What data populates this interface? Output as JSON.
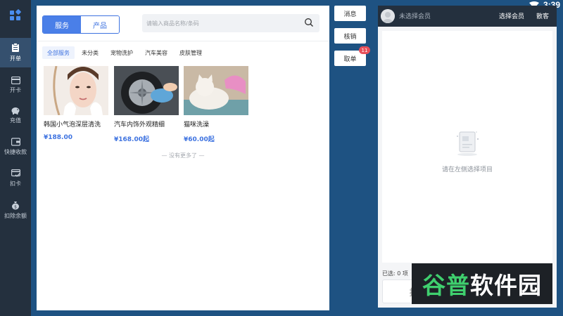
{
  "status_bar": {
    "time": "3:39"
  },
  "sidebar": {
    "items": [
      {
        "label": "开单",
        "icon": "clipboard-icon"
      },
      {
        "label": "开卡",
        "icon": "card-icon"
      },
      {
        "label": "充值",
        "icon": "piggy-bank-icon"
      },
      {
        "label": "快捷收款",
        "icon": "wallet-icon"
      },
      {
        "label": "扣卡",
        "icon": "card-check-icon"
      },
      {
        "label": "扣除余额",
        "icon": "money-bag-icon"
      }
    ],
    "active_index": 0
  },
  "products": {
    "tabs": [
      "服务",
      "产品"
    ],
    "active_tab": 0,
    "search_placeholder": "请输入商品名称/条码",
    "categories": [
      "全部服务",
      "未分类",
      "宠物洗护",
      "汽车美容",
      "皮肤管理"
    ],
    "active_category": 0,
    "items": [
      {
        "title": "韩国小气泡深层清洗",
        "price": "¥188.00"
      },
      {
        "title": "汽车内饰外观精细",
        "price": "¥168.00起"
      },
      {
        "title": "猫咪洗澡",
        "price": "¥60.00起"
      }
    ],
    "no_more": "— 没有更多了 —"
  },
  "actions": {
    "message": "消息",
    "verify": "核销",
    "take_order": "取单",
    "take_order_badge": "11"
  },
  "cart": {
    "member_status": "未选择会员",
    "choose_member": "选择会员",
    "walk_in": "散客",
    "empty_hint": "请在左侧选择项目",
    "selected_count": "已选: 0 项",
    "hold_label": "挂"
  },
  "watermark": {
    "green": "谷普",
    "white": "软件园"
  },
  "colors": {
    "accent": "#4a7fe8",
    "sidebar": "#24303e",
    "background": "#1e5282",
    "badge": "#e8505a"
  }
}
